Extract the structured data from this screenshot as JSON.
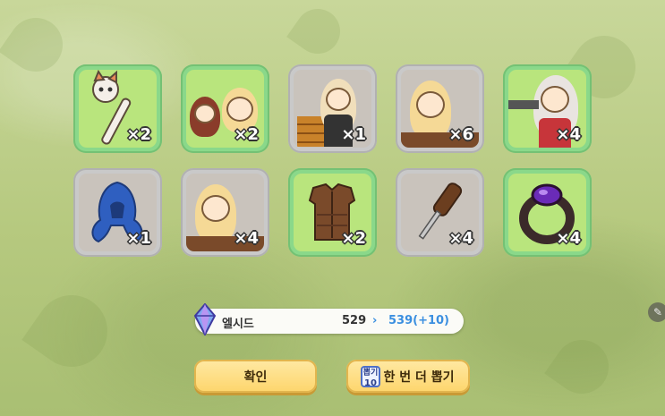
{
  "items": [
    {
      "name": "cat-staff",
      "frame": "green",
      "qty": "×2"
    },
    {
      "name": "character-card-1",
      "frame": "green",
      "qty": "×2"
    },
    {
      "name": "character-card-2",
      "frame": "gray",
      "qty": "×1"
    },
    {
      "name": "character-card-3",
      "frame": "gray",
      "qty": "×6"
    },
    {
      "name": "character-card-4",
      "frame": "green",
      "qty": "×4"
    },
    {
      "name": "blue-hood",
      "frame": "gray",
      "qty": "×1"
    },
    {
      "name": "character-card-5",
      "frame": "gray",
      "qty": "×4"
    },
    {
      "name": "leather-armor",
      "frame": "green",
      "qty": "×2"
    },
    {
      "name": "screwdriver",
      "frame": "gray",
      "qty": "×4"
    },
    {
      "name": "purple-gem-ring",
      "frame": "green",
      "qty": "×4"
    }
  ],
  "resource": {
    "name": "엘시드",
    "old": "529",
    "arrow": "›",
    "new": "539(+10)",
    "icon": "crystal-icon"
  },
  "buttons": {
    "confirm": "확인",
    "again": "한 번 더 뽑기",
    "ticket_top": "뽑기",
    "ticket_count": "10"
  },
  "colors": {
    "green_frame": "#8ad88a",
    "gray_frame": "#c9c9c9",
    "button_yellow": "#fdd56b",
    "accent_blue": "#3b8fe0"
  }
}
